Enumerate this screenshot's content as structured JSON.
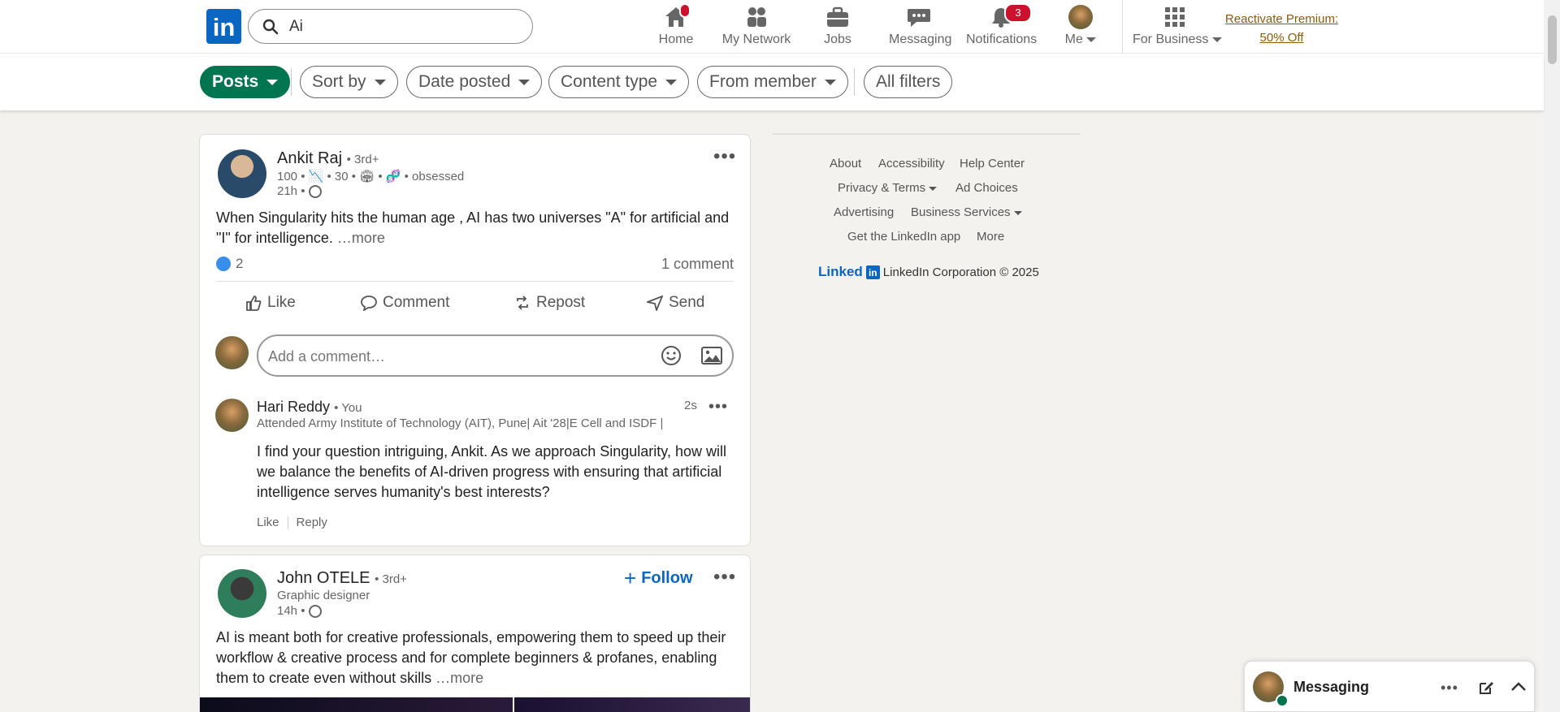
{
  "brand": {
    "logo_text": "in",
    "accent": "#0a66c2",
    "green": "#01754f"
  },
  "search": {
    "value": "Ai",
    "icon": "search-icon"
  },
  "nav": {
    "home": {
      "label": "Home",
      "has_dot": true
    },
    "network": {
      "label": "My Network"
    },
    "jobs": {
      "label": "Jobs"
    },
    "messaging": {
      "label": "Messaging"
    },
    "notifications": {
      "label": "Notifications",
      "badge": "3"
    },
    "me": {
      "label": "Me"
    },
    "business": {
      "label": "For Business"
    },
    "premium_line1": "Reactivate Premium:",
    "premium_line2": "50% Off"
  },
  "filters": {
    "posts": "Posts",
    "sort_by": "Sort by",
    "date_posted": "Date posted",
    "content_type": "Content type",
    "from_member": "From member",
    "all_filters": "All filters"
  },
  "post1": {
    "author": "Ankit Raj",
    "degree": "• 3rd+",
    "headline": "100 • 📉 • 30 • 🏟 • 🧬 • obsessed",
    "time": "21h •",
    "text": "When Singularity hits the human age , AI has two universes \"A\" for artificial and \"I\" for intelligence.",
    "more": "…more",
    "reactions": "2",
    "comments": "1 comment",
    "actions": {
      "like": "Like",
      "comment": "Comment",
      "repost": "Repost",
      "send": "Send"
    },
    "comment_placeholder": "Add a comment…",
    "reply": {
      "author": "Hari Reddy",
      "you": "• You",
      "time": "2s",
      "headline": "Attended Army Institute of Technology (AIT), Pune| Ait '28|E Cell and ISDF |",
      "text": "I find your question intriguing, Ankit. As we approach Singularity, how will we balance the benefits of AI-driven progress with ensuring that artificial intelligence serves humanity's best interests?",
      "like": "Like",
      "reply": "Reply"
    }
  },
  "post2": {
    "author": "John OTELE",
    "degree": "• 3rd+",
    "headline": "Graphic designer",
    "time": "14h •",
    "follow": "Follow",
    "text": "AI is meant both for creative professionals, empowering them to speed up their workflow & creative process and for complete beginners & profanes, enabling them to create even without skills",
    "more": "…more"
  },
  "footer": {
    "about": "About",
    "accessibility": "Accessibility",
    "help": "Help Center",
    "privacy": "Privacy & Terms",
    "ad_choices": "Ad Choices",
    "advertising": "Advertising",
    "business_services": "Business Services",
    "get_app": "Get the LinkedIn app",
    "more": "More",
    "logo_text": "Linked",
    "copyright": "LinkedIn Corporation © 2025"
  },
  "messaging_bar": {
    "label": "Messaging"
  }
}
